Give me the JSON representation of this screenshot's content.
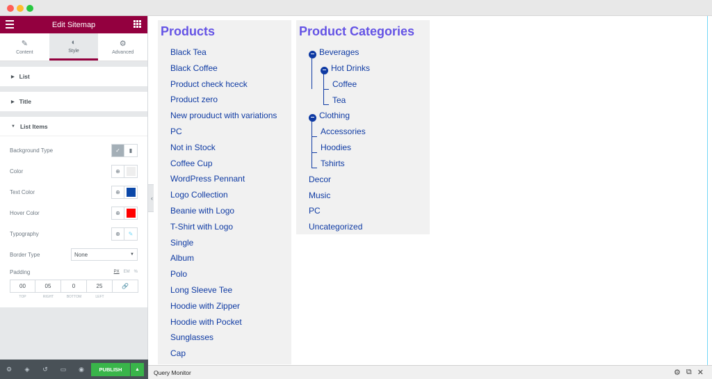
{
  "panel": {
    "title": "Edit Sitemap",
    "tabs": [
      {
        "label": "Content",
        "icon": "pencil-icon"
      },
      {
        "label": "Style",
        "icon": "contrast-icon"
      },
      {
        "label": "Advanced",
        "icon": "gear-icon"
      }
    ],
    "sections": {
      "list": "List",
      "title": "Title",
      "list_items": "List Items"
    },
    "controls": {
      "background_type": "Background Type",
      "color": "Color",
      "text_color": "Text Color",
      "hover_color": "Hover Color",
      "typography": "Typography",
      "border_type": "Border Type",
      "border_type_value": "None",
      "padding": "Padding",
      "units": [
        "PX",
        "EM",
        "%"
      ],
      "padding_values": [
        "00",
        "05",
        "0",
        "25"
      ],
      "padding_labels": [
        "TOP",
        "RIGHT",
        "BOTTOM",
        "LEFT"
      ]
    },
    "colors": {
      "color_swatch": "#eeeeee",
      "text_color_swatch": "#0a47a8",
      "hover_color_swatch": "#ff0000",
      "accent": "#93003f"
    },
    "footer": {
      "publish": "PUBLISH"
    }
  },
  "canvas": {
    "products": {
      "title": "Products",
      "items": [
        "Black Tea",
        "Black Coffee",
        "Product check hceck",
        "Product zero",
        "New prouduct with variations",
        "PC",
        "Not in Stock",
        "Coffee Cup",
        "WordPress Pennant",
        "Logo Collection",
        "Beanie with Logo",
        "T-Shirt with Logo",
        "Single",
        "Album",
        "Polo",
        "Long Sleeve Tee",
        "Hoodie with Zipper",
        "Hoodie with Pocket",
        "Sunglasses",
        "Cap"
      ]
    },
    "categories": {
      "title": "Product Categories",
      "beverages": "Beverages",
      "hot_drinks": "Hot Drinks",
      "coffee": "Coffee",
      "tea": "Tea",
      "clothing": "Clothing",
      "accessories": "Accessories",
      "hoodies": "Hoodies",
      "tshirts": "Tshirts",
      "decor": "Decor",
      "music": "Music",
      "pc": "PC",
      "uncategorized": "Uncategorized"
    }
  },
  "query_monitor": {
    "label": "Query Monitor"
  }
}
